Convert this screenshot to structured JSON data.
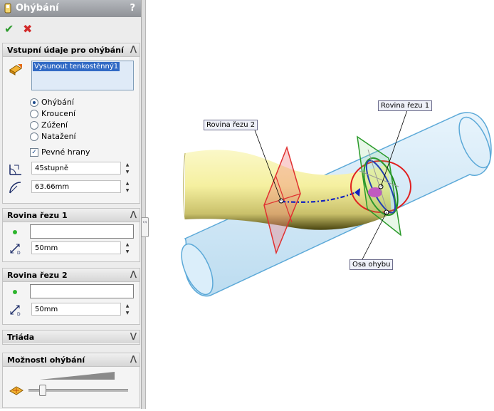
{
  "panel": {
    "title": "Ohýbání",
    "help": "?",
    "ok_icon": "checkmark-icon",
    "cancel_icon": "close-icon",
    "colors": {
      "ok": "#2e9b2e",
      "cancel": "#d22a2a",
      "selection": "#316ac5",
      "dot": "#2db52d"
    }
  },
  "input_group": {
    "title": "Vstupní údaje pro ohýbání",
    "body": "Vysunout tenkostěnný1",
    "options": [
      "Ohýbání",
      "Kroucení",
      "Zúžení",
      "Natažení"
    ],
    "selected_option": "Ohýbání",
    "rigid_edges_label": "Pevné hrany",
    "rigid_edges_checked": true,
    "angle": "45stupně",
    "radius": "63.66mm"
  },
  "plane1_group": {
    "title": "Rovina řezu 1",
    "selection": "",
    "distance": "50mm"
  },
  "plane2_group": {
    "title": "Rovina řezu 2",
    "selection": "",
    "distance": "50mm"
  },
  "triad_group": {
    "title": "Triáda"
  },
  "options_group": {
    "title": "Možnosti ohýbání",
    "precision": 0.1
  },
  "viewport": {
    "callouts": {
      "plane2": "Rovina řezu 2",
      "plane1": "Rovina řezu 1",
      "axis": "Osa ohybu"
    },
    "colors": {
      "solid": "#f7f3a8",
      "ghost": "#cfe6f6",
      "plane2": "#e03030",
      "plane1": "#2a9a2a",
      "axis": "#1020c0"
    }
  }
}
